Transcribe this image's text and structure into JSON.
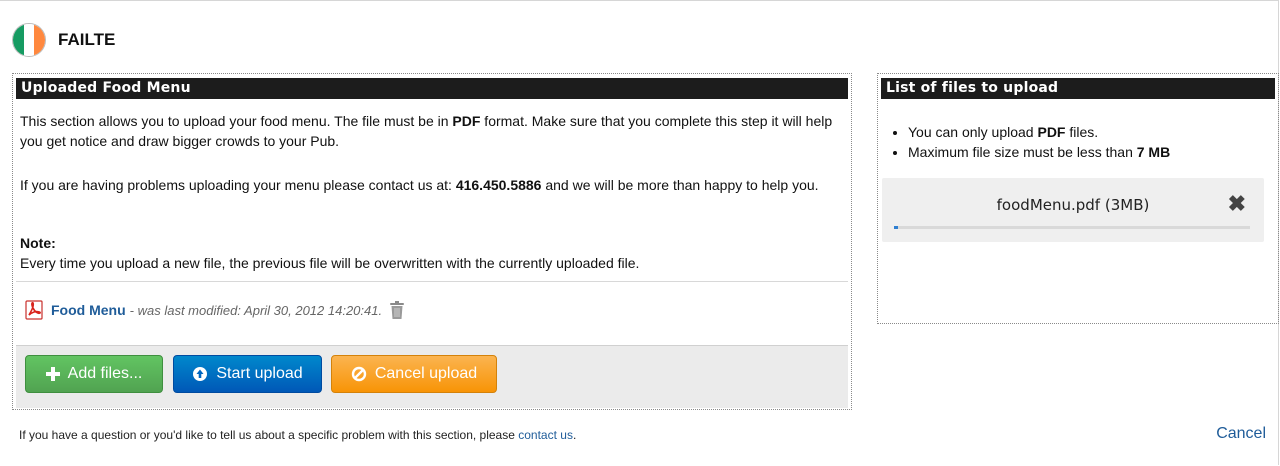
{
  "header": {
    "title": "FAILTE",
    "flag_colors": [
      "#169B62",
      "#FFFFFF",
      "#FF883E"
    ]
  },
  "left_panel": {
    "title": "Uploaded Food Menu",
    "p1_before": "This section allows you to upload your food menu. The file must be in ",
    "p1_bold": "PDF",
    "p1_after": " format. Make sure that you complete this step it will help you get notice and draw bigger crowds to your Pub.",
    "p2_before": "If you are having problems uploading your menu please contact us at: ",
    "p2_phone": "416.450.5886",
    "p2_after": " and we will be more than happy to help you.",
    "note_label": "Note:",
    "note_text": "Every time you upload a new file, the previous file will be overwritten with the currently uploaded file.",
    "file": {
      "icon": "pdf-icon",
      "name": "Food Menu",
      "meta": "- was last modified: April 30, 2012 14:20:41.",
      "delete_icon": "trash-icon"
    },
    "buttons": {
      "add": "Add files...",
      "start": "Start upload",
      "cancel": "Cancel upload"
    }
  },
  "right_panel": {
    "title": "List of files to upload",
    "rule1_before": "You can only upload ",
    "rule1_bold": "PDF",
    "rule1_after": " files.",
    "rule2_before": "Maximum file size must be less than ",
    "rule2_bold": "7 MB",
    "queued_file": {
      "name": "foodMenu.pdf (3MB)",
      "progress_pct": 1
    }
  },
  "footer": {
    "text": "If you have a question or you'd like to tell us about a specific problem with this section, please ",
    "link": "contact us",
    "end": ".",
    "cancel": "Cancel"
  }
}
